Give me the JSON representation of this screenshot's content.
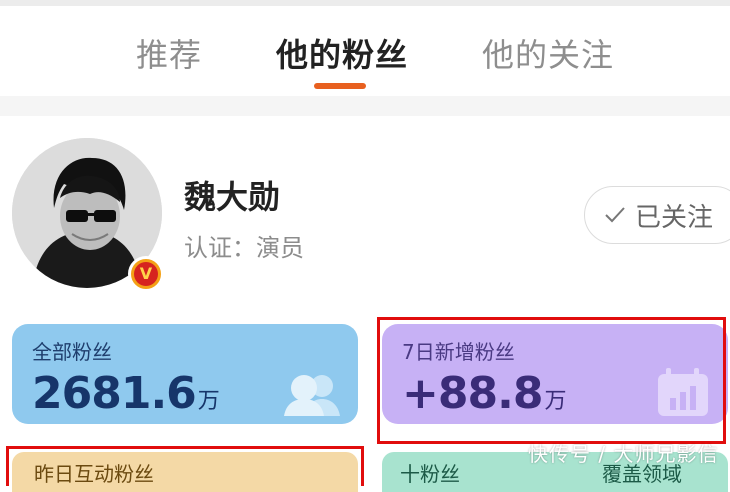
{
  "tabs": [
    {
      "label": "推荐",
      "active": false
    },
    {
      "label": "他的粉丝",
      "active": true
    },
    {
      "label": "他的关注",
      "active": false
    }
  ],
  "profile": {
    "name": "魏大勋",
    "verification": "认证：演员",
    "badge": "V",
    "follow_button": "已关注"
  },
  "stats": {
    "total_fans": {
      "label": "全部粉丝",
      "value": "2681.6",
      "unit": "万"
    },
    "new_fans_7d": {
      "label": "7日新增粉丝",
      "value": "+88.8",
      "unit": "万"
    }
  },
  "next_row": {
    "left_label": "昨日互动粉丝",
    "right_label": "十粉丝",
    "right_label_2": "覆盖领域"
  },
  "watermark": "快传号 / 大师兄影信",
  "colors": {
    "accent": "#e8601f",
    "blue_card": "#8fc9ee",
    "purple_card": "#c7b1f5",
    "highlight": "#e10d0d"
  }
}
